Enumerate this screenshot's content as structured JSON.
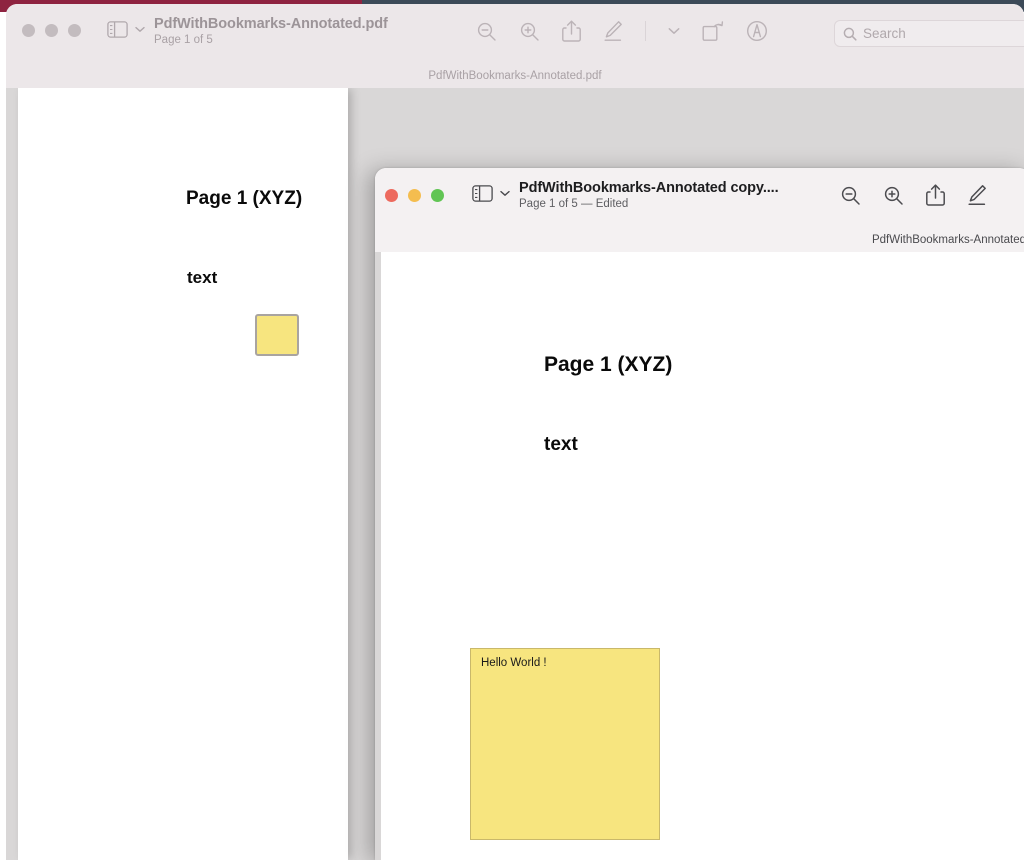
{
  "desktop": {
    "colors": {
      "maroon": "#8e2340",
      "slate": "#3c4a58"
    }
  },
  "back_window": {
    "title": "PdfWithBookmarks-Annotated.pdf",
    "subtitle": "Page 1 of 5",
    "proxy_title": "PdfWithBookmarks-Annotated.pdf",
    "state": "inactive",
    "traffic_lights": [
      {
        "name": "close",
        "color": "#c3bcbf"
      },
      {
        "name": "minimize",
        "color": "#c3bcbf"
      },
      {
        "name": "zoom",
        "color": "#c3bcbf"
      }
    ],
    "sidebar_toggle": {
      "icon": "sidebar-icon",
      "chevron": "chevron-down-icon"
    },
    "toolbar": [
      {
        "icon": "zoom-out-icon",
        "label": "Zoom Out"
      },
      {
        "icon": "zoom-in-icon",
        "label": "Zoom In"
      },
      {
        "icon": "share-icon",
        "label": "Share"
      },
      {
        "icon": "markup-pen-icon",
        "label": "Markup"
      },
      {
        "icon": "divider",
        "label": ""
      },
      {
        "icon": "chevron-down-icon",
        "label": "Markup Options"
      },
      {
        "icon": "rotate-right-icon",
        "label": "Rotate Right"
      },
      {
        "icon": "annotate-icon",
        "label": "Annotate"
      }
    ],
    "search": {
      "placeholder": "Search",
      "value": "",
      "icon": "search-icon"
    },
    "page": {
      "heading": "Page 1 (XYZ)",
      "body_text": "text",
      "note": {
        "type": "collapsed-note",
        "fill": "#f7e57f",
        "border": "#a9a4a0"
      }
    }
  },
  "front_window": {
    "title": "PdfWithBookmarks-Annotated copy....",
    "subtitle": "Page 1 of 5 — Edited",
    "proxy_title": "PdfWithBookmarks-Annotated",
    "state": "active",
    "traffic_lights": [
      {
        "name": "close",
        "color": "#ed6a5e"
      },
      {
        "name": "minimize",
        "color": "#f4bd4f"
      },
      {
        "name": "zoom",
        "color": "#61c554"
      }
    ],
    "sidebar_toggle": {
      "icon": "sidebar-icon",
      "chevron": "chevron-down-icon"
    },
    "toolbar": [
      {
        "icon": "zoom-out-icon",
        "label": "Zoom Out"
      },
      {
        "icon": "zoom-in-icon",
        "label": "Zoom In"
      },
      {
        "icon": "share-icon",
        "label": "Share"
      },
      {
        "icon": "markup-pen-icon",
        "label": "Markup"
      }
    ],
    "page": {
      "heading": "Page 1 (XYZ)",
      "body_text": "text",
      "note": {
        "type": "expanded-note",
        "text": "Hello World !",
        "fill": "#f7e57f",
        "border": "#c9b86a"
      }
    }
  }
}
